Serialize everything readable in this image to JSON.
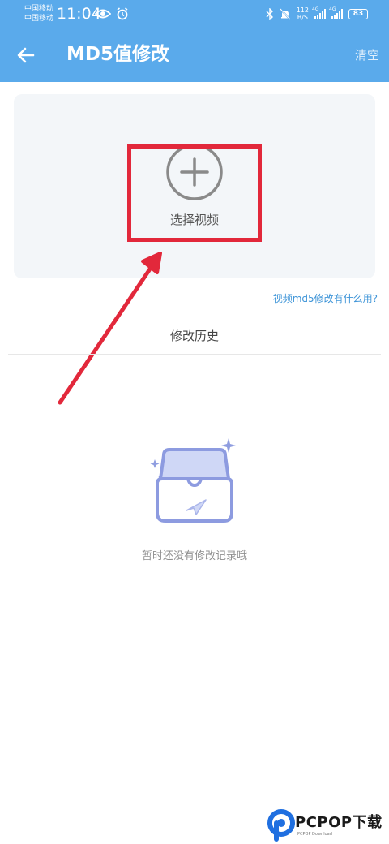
{
  "status_bar": {
    "carrier_1": "中国移动",
    "carrier_2": "中国移动",
    "time": "11:04",
    "net_speed_value": "112",
    "net_speed_unit": "B/S",
    "signal_1_label": "4G",
    "signal_2_label": "4G",
    "battery": "83"
  },
  "header": {
    "title": "MD5值修改",
    "clear_label": "清空"
  },
  "upload": {
    "label": "选择视频"
  },
  "help_link": "视频md5修改有什么用?",
  "history": {
    "title": "修改历史",
    "empty_text": "暂时还没有修改记录哦"
  },
  "watermark": {
    "brand": "PCPOP下载",
    "sub": "PCPOP Download"
  },
  "colors": {
    "header_bg": "#5aaaeb",
    "panel_bg": "#f3f6f9",
    "annotation_red": "#e2283b",
    "link_blue": "#3f95d8"
  }
}
